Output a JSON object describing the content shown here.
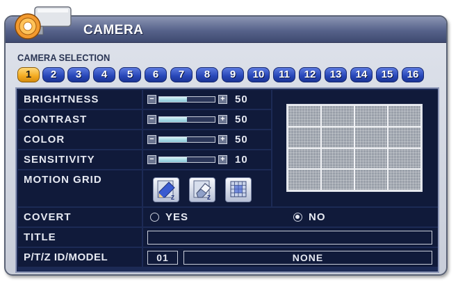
{
  "window": {
    "title": "CAMERA",
    "colors": {
      "titlebar": "#56628a",
      "panel": "#1c2a55",
      "row": "#101a3a",
      "tab": "#2746b7",
      "tab_active": "#f3aa20"
    }
  },
  "camera_icon": "security-camera-icon",
  "camera_selection": {
    "label": "CAMERA SELECTION",
    "selected": "1",
    "tabs": [
      "1",
      "2",
      "3",
      "4",
      "5",
      "6",
      "7",
      "8",
      "9",
      "10",
      "11",
      "12",
      "13",
      "14",
      "15",
      "16"
    ]
  },
  "settings": {
    "brightness": {
      "label": "BRIGHTNESS",
      "value": "50",
      "level": 0.5
    },
    "contrast": {
      "label": "CONTRAST",
      "value": "50",
      "level": 0.5
    },
    "color": {
      "label": "COLOR",
      "value": "50",
      "level": 0.5
    },
    "sensitivity": {
      "label": "SENSITIVITY",
      "value": "10",
      "level": 0.5
    }
  },
  "motion_grid": {
    "label": "MOTION GRID",
    "buttons": [
      "pencil-icon",
      "eraser-icon",
      "grid-select-icon"
    ],
    "grid_rows": 4,
    "grid_cols": 4
  },
  "covert": {
    "label": "COVERT",
    "yes": "YES",
    "no": "NO",
    "selected": "NO"
  },
  "title": {
    "label": "TITLE",
    "value": ""
  },
  "ptz": {
    "label": "P/T/Z ID/MODEL",
    "id": "01",
    "model": "NONE"
  }
}
